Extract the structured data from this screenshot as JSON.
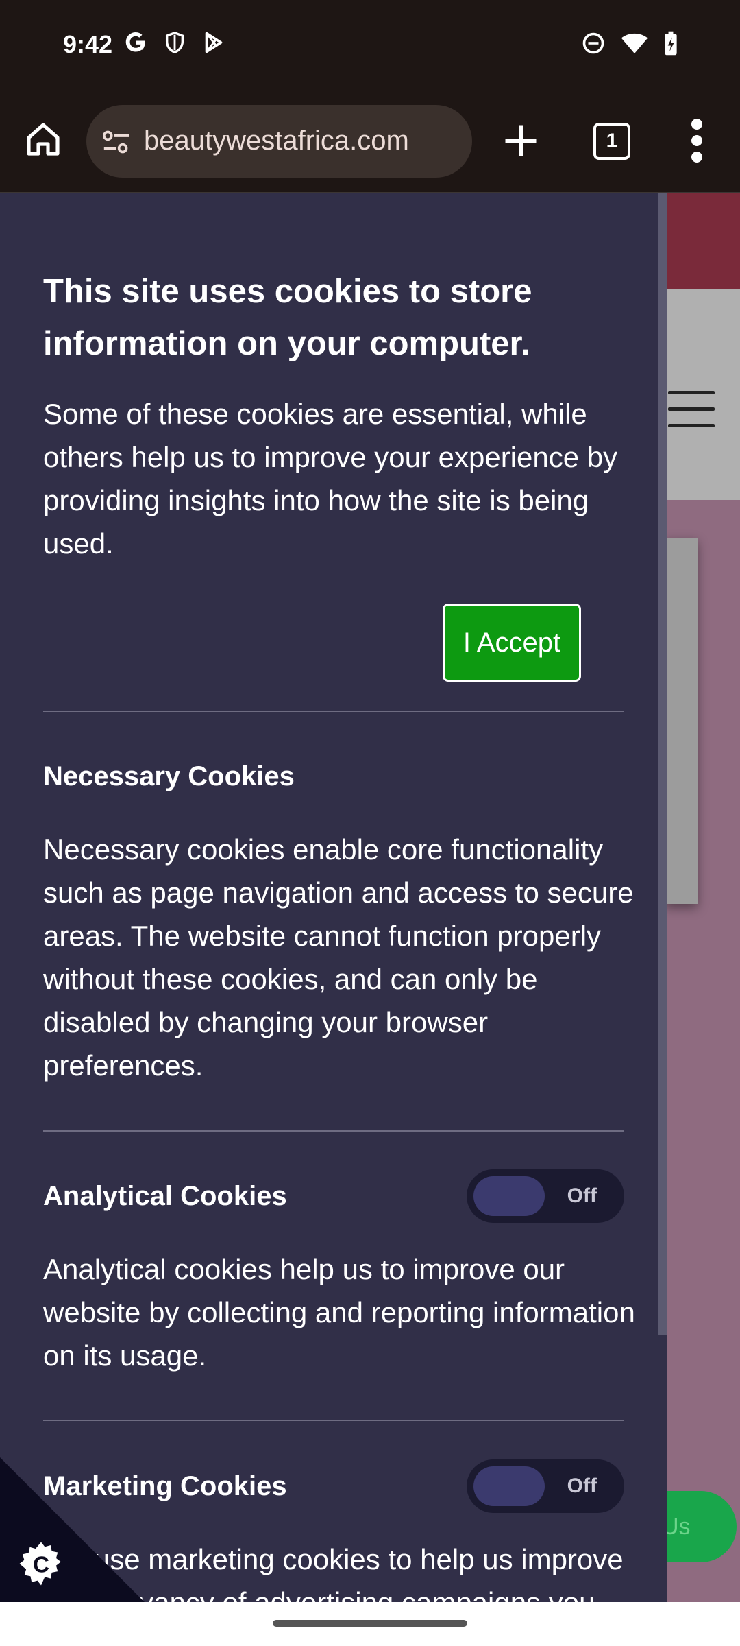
{
  "status_bar": {
    "time": "9:42",
    "left_icons": [
      "google-icon",
      "shield-icon",
      "play-store-icon"
    ],
    "right_icons": [
      "do-not-disturb-icon",
      "wifi-icon",
      "battery-charging-icon"
    ]
  },
  "browser": {
    "url": "beautywestafrica.com",
    "tab_count": "1"
  },
  "cookie_panel": {
    "title": "This site uses cookies to store information on your computer.",
    "intro": "Some of these cookies are essential, while others help us to improve your experience by providing insights into how the site is being used.",
    "accept_label": "I Accept",
    "sections": [
      {
        "title": "Necessary Cookies",
        "text": "Necessary cookies enable core functionality such as page navigation and access to secure areas. The website cannot function properly without these cookies, and can only be disabled by changing your browser preferences."
      },
      {
        "title": "Analytical Cookies",
        "toggle_label": "Off",
        "text": "Analytical cookies help us to improve our website by collecting and reporting information on its usage."
      },
      {
        "title": "Marketing Cookies",
        "toggle_label": "Off",
        "text": "We use marketing cookies to help us improve the relevancy of advertising campaigns you"
      }
    ]
  },
  "background_page": {
    "contact_button_label": "Us"
  },
  "colors": {
    "panel_bg": "#312f48",
    "accept_green": "#0d9a11",
    "browser_bar": "#1e1614"
  }
}
